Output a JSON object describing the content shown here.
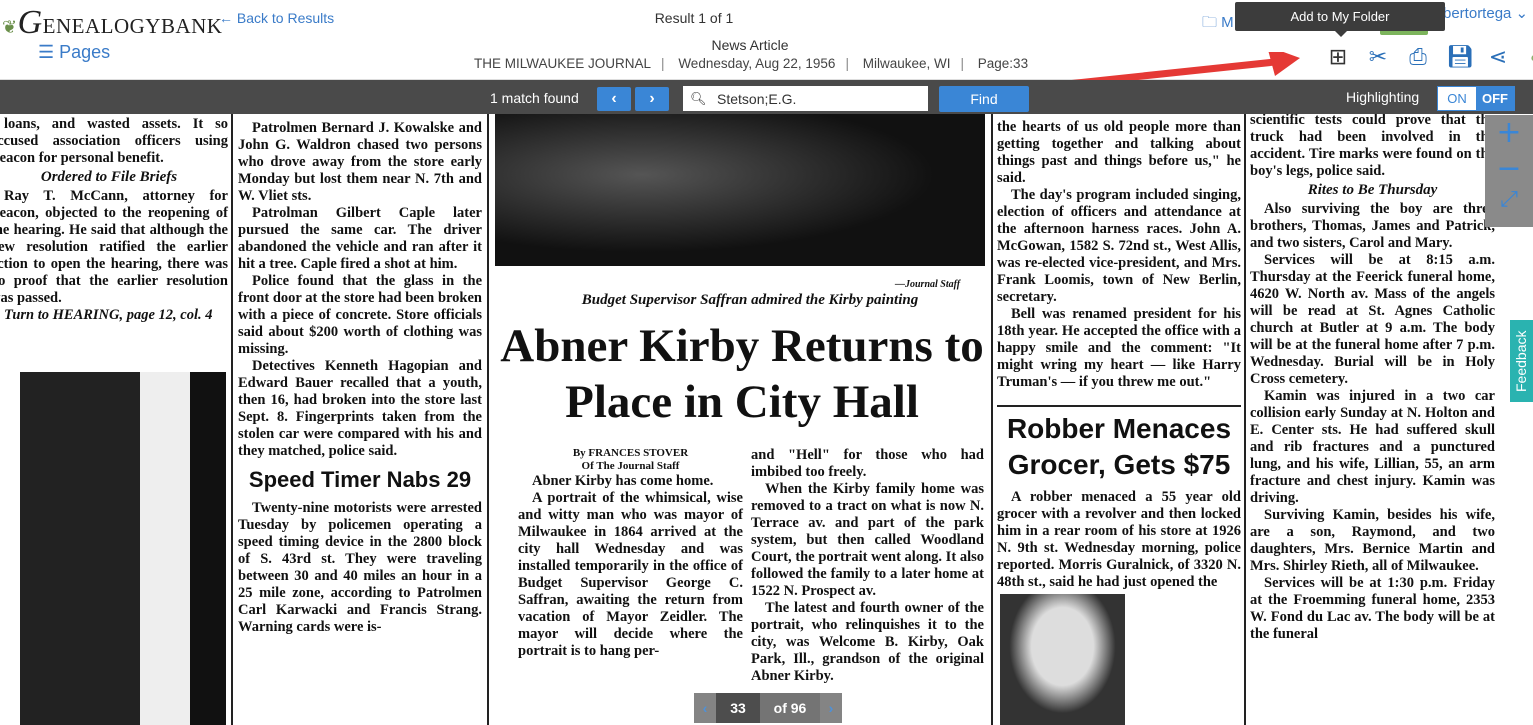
{
  "header": {
    "logo": "GenealogyBank",
    "back": "Back to Results",
    "pages": "Pages",
    "result": "Result 1 of 1",
    "doc_type": "News Article",
    "meta": [
      "THE MILWAUKEE JOURNAL",
      "Wednesday, Aug 22, 1956",
      "Milwaukee, WI",
      "Page:33"
    ],
    "my_folder": "M",
    "user": "bertortega",
    "tooltip": "Add to My Folder",
    "tools": [
      "add-folder",
      "clip",
      "print",
      "save",
      "share",
      "tree"
    ]
  },
  "toolbar": {
    "match": "1 match found",
    "search_value": "Stetson;E.G.",
    "find": "Find",
    "highlighting": "Highlighting",
    "on": "ON",
    "off": "OFF",
    "accent": "#3a86d6"
  },
  "paper": {
    "col1": {
      "p1": "loans, and wasted assets. It so accused association officers using Beacon for personal benefit.",
      "head": "Ordered to File Briefs",
      "p2": "Ray T. McCann, attorney for Beacon, objected to the reopening of the hearing. He said that although the new resolution ratified the earlier action to open the hearing, there was no proof that the earlier resolution was passed.",
      "p3": "Turn to HEARING, page 12, col. 4"
    },
    "col2": {
      "p1": "Patrolmen Bernard J. Kowalske and John G. Waldron chased two persons who drove away from the store early Monday but lost them near N. 7th and W. Vliet sts.",
      "p2": "Patrolman Gilbert Caple later pursued the same car. The driver abandoned the vehicle and ran after it hit a tree. Caple fired a shot at him.",
      "p3": "Police found that the glass in the front door at the store had been broken with a piece of concrete. Store officials said about $200 worth of clothing was missing.",
      "p4": "Detectives Kenneth Hagopian and Edward Bauer recalled that a youth, then 16, had broken into the store last Sept. 8. Fingerprints taken from the stolen car were compared with his and they matched, police said.",
      "head": "Speed Timer Nabs 29",
      "p5": "Twenty-nine motorists were arrested Tuesday by policemen operating a speed timing device in the 2800 block of S. 43rd st. They were traveling between 30 and 40 miles an hour in a 25 mile zone, according to Patrolmen Carl Karwacki and Francis Strang. Warning cards were is-"
    },
    "photo_credit": "—Journal Staff",
    "caption": "Budget Supervisor Saffran admired the Kirby painting",
    "headline": "Abner Kirby Returns to Place in City Hall",
    "byline": "By FRANCES STOVER",
    "byline2": "Of The Journal Staff",
    "col3a": {
      "p1": "Abner Kirby has come home.",
      "p2": "A portrait of the whimsical, wise and witty man who was mayor of Milwaukee in 1864 arrived at the city hall Wednesday and was installed temporarily in the office of Budget Supervisor George C. Saffran, awaiting the return from vacation of Mayor Zeidler. The mayor will decide where the portrait is to hang per-"
    },
    "col3b": {
      "p1": "and \"Hell\" for those who had imbibed too freely.",
      "p2": "When the Kirby family home was removed to a tract on what is now N. Terrace av. and part of the park system, but then called Woodland Court, the portrait went along. It also followed the family to a later home at 1522 N. Prospect av.",
      "p3": "The latest and fourth owner of the portrait, who relinquishes it to the city, was Welcome B. Kirby, Oak Park, Ill., grandson of the original Abner Kirby."
    },
    "col4": {
      "p1": "the hearts of us old people more than getting together and talking about things past and things before us,\" he said.",
      "p2": "The day's program included singing, election of officers and attendance at the afternoon harness races. John A. McGowan, 1582 S. 72nd st., West Allis, was re-elected vice-president, and Mrs. Frank Loomis, town of New Berlin, secretary.",
      "p3": "Bell was renamed president for his 18th year. He accepted the office with a happy smile and the comment: \"It might wring my heart — like Harry Truman's — if you threw me out.\"",
      "head": "Robber Menaces Grocer, Gets $75",
      "p4": "A robber menaced a 55 year old grocer with a revolver and then locked him in a rear room of his store at 1926 N. 9th st. Wednesday morning, police reported. Morris Guralnick, of 3320 N. 48th st., said he had just opened the"
    },
    "col5": {
      "p1": "scientific tests could prove that the truck had been involved in the accident. Tire marks were found on the boy's legs, police said.",
      "head": "Rites to Be Thursday",
      "p2": "Also surviving the boy are three brothers, Thomas, James and Patrick, and two sisters, Carol and Mary.",
      "p3": "Services will be at 8:15 a.m. Thursday at the Feerick funeral home, 4620 W. North av. Mass of the angels will be read at St. Agnes Catholic church at Butler at 9 a.m. The body will be at the funeral home after 7 p.m. Wednesday. Burial will be in Holy Cross cemetery.",
      "p4": "Kamin was injured in a two car collision early Sunday at N. Holton and E. Center sts. He had suffered skull and rib fractures and a punctured lung, and his wife, Lillian, 55, an arm fracture and chest injury. Kamin was driving.",
      "p5": "Surviving Kamin, besides his wife, are a son, Raymond, and two daughters, Mrs. Bernice Martin and Mrs. Shirley Rieth, all of Milwaukee.",
      "p6": "Services will be at 1:30 p.m. Friday at the Froemming funeral home, 2353 W. Fond du Lac av. The body will be at the funeral"
    }
  },
  "viewer": {
    "feedback": "Feedback",
    "page": "33",
    "of": "of 96"
  }
}
